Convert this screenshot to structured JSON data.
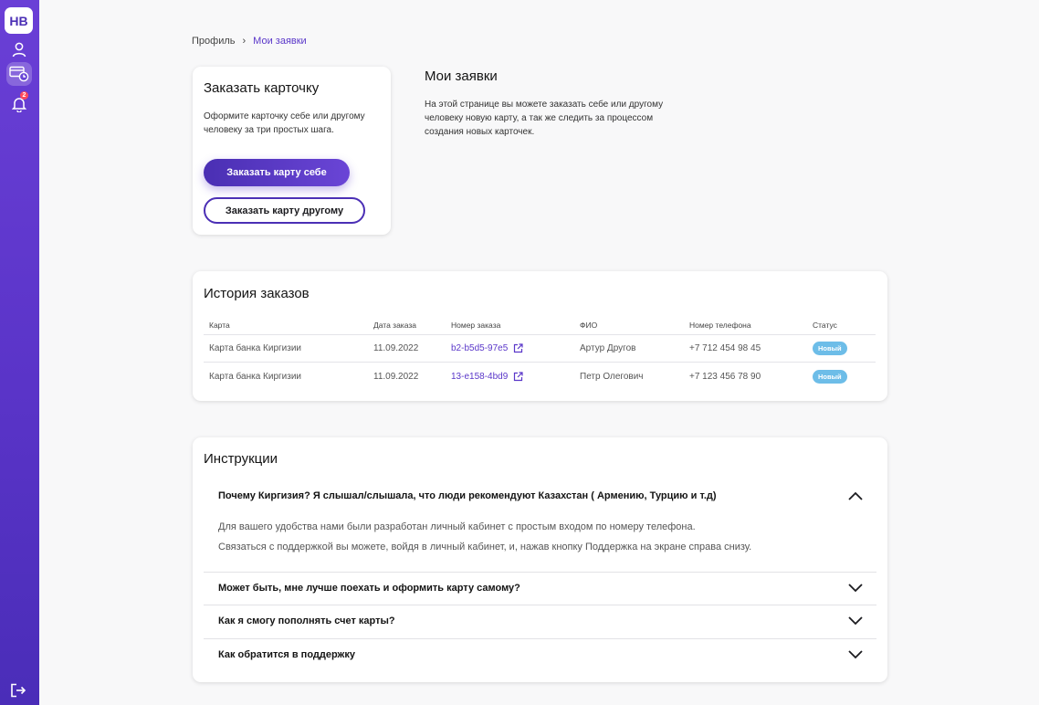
{
  "sidebar": {
    "logo": "НВ",
    "notification_count": "2",
    "icons": [
      "profile-icon",
      "card-history-icon",
      "bell-icon",
      "logout-icon"
    ]
  },
  "breadcrumb": {
    "parent": "Профиль",
    "separator": "›",
    "current": "Мои заявки"
  },
  "order_card": {
    "title": "Заказать карточку",
    "description": "Оформите карточку себе или другому человеку за три простых шага.",
    "primary_button": "Заказать карту себе",
    "secondary_button": "Заказать карту другому"
  },
  "info": {
    "title": "Мои заявки",
    "text": "На этой странице вы можете заказать себе или другому человеку новую карту, а так же следить за процессом создания новых карточек."
  },
  "history": {
    "title": "История заказов",
    "columns": [
      "Карта",
      "Дата заказа",
      "Номер заказа",
      "ФИО",
      "Номер телефона",
      "Статус"
    ],
    "rows": [
      {
        "card": "Карта банка Киргизии",
        "date": "11.09.2022",
        "order": "b2-b5d5-97e5",
        "name": "Артур Другов",
        "phone": "+7 712 454 98 45",
        "status": "Новый"
      },
      {
        "card": "Карта банка Киргизии",
        "date": "11.09.2022",
        "order": "13-e158-4bd9",
        "name": "Петр Олегович",
        "phone": "+7 123 456 78 90",
        "status": "Новый"
      }
    ]
  },
  "instructions": {
    "title": "Инструкции",
    "items": [
      {
        "question": "Почему Киргизия? Я слышал/слышала, что люди рекомендуют Казахстан ( Армению, Турцию и т.д)",
        "expanded": true,
        "answer": [
          "Для вашего удобства нами были разработан личный кабинет с простым входом по номеру телефона.",
          "Связаться с поддержкой вы можете, войдя в личный кабинет, и, нажав кнопку Поддержка на экране справа снизу."
        ]
      },
      {
        "question": "Может быть, мне лучше поехать и оформить карту самому?",
        "expanded": false
      },
      {
        "question": "Как я смогу пополнять счет карты?",
        "expanded": false
      },
      {
        "question": "Как обратится в поддержку",
        "expanded": false
      }
    ]
  },
  "colors": {
    "accent": "#5a37c9",
    "sidebar": "#5a34c8",
    "status_new": "#6dbde8"
  }
}
